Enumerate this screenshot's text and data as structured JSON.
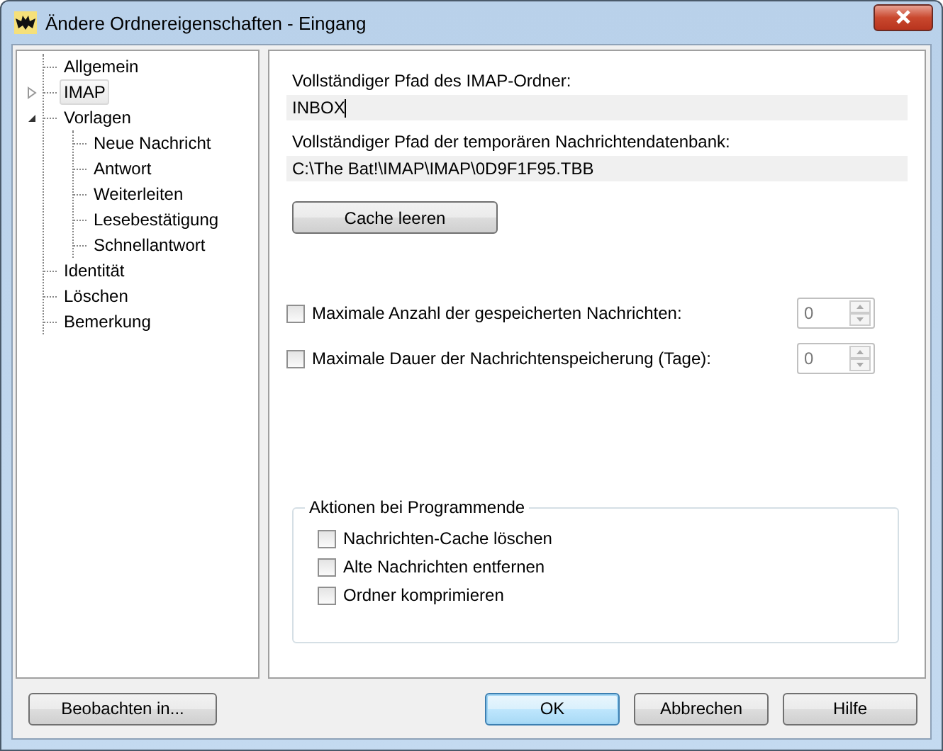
{
  "window": {
    "title": "Ändere Ordnereigenschaften - Eingang"
  },
  "tree": [
    {
      "label": "Allgemein",
      "kind": "leaf",
      "selected": false
    },
    {
      "label": "IMAP",
      "kind": "branch",
      "expanded": false,
      "selected": true
    },
    {
      "label": "Vorlagen",
      "kind": "branch",
      "expanded": true,
      "selected": false,
      "children": [
        {
          "label": "Neue Nachricht",
          "selected": false
        },
        {
          "label": "Antwort",
          "selected": false
        },
        {
          "label": "Weiterleiten",
          "selected": false
        },
        {
          "label": "Lesebestätigung",
          "selected": false
        },
        {
          "label": "Schnellantwort",
          "selected": false
        }
      ]
    },
    {
      "label": "Identität",
      "kind": "leaf",
      "selected": false
    },
    {
      "label": "Löschen",
      "kind": "leaf",
      "selected": false
    },
    {
      "label": "Bemerkung",
      "kind": "leaf",
      "selected": false
    }
  ],
  "imap": {
    "folder_path_label": "Vollständiger Pfad des IMAP-Ordner:",
    "folder_path": "INBOX",
    "db_path_label": "Vollständiger Pfad der temporären Nachrichtendatenbank:",
    "db_path": "C:\\The Bat!\\IMAP\\IMAP\\0D9F1F95.TBB",
    "clear_cache_button": "Cache leeren",
    "limits": [
      {
        "label": "Maximale Anzahl der gespeicherten Nachrichten:",
        "checked": false,
        "value": "0"
      },
      {
        "label": "Maximale Dauer der Nachrichtenspeicherung (Tage):",
        "checked": false,
        "value": "0"
      }
    ],
    "exit_group": {
      "title": "Aktionen bei Programmende",
      "options": [
        {
          "label": "Nachrichten-Cache löschen",
          "checked": false
        },
        {
          "label": "Alte Nachrichten entfernen",
          "checked": false
        },
        {
          "label": "Ordner komprimieren",
          "checked": false
        }
      ]
    }
  },
  "buttons": {
    "left": "Beobachten in...",
    "right": [
      {
        "label": "OK",
        "default": true
      },
      {
        "label": "Abbrechen",
        "default": false
      },
      {
        "label": "Hilfe",
        "default": false
      }
    ]
  }
}
